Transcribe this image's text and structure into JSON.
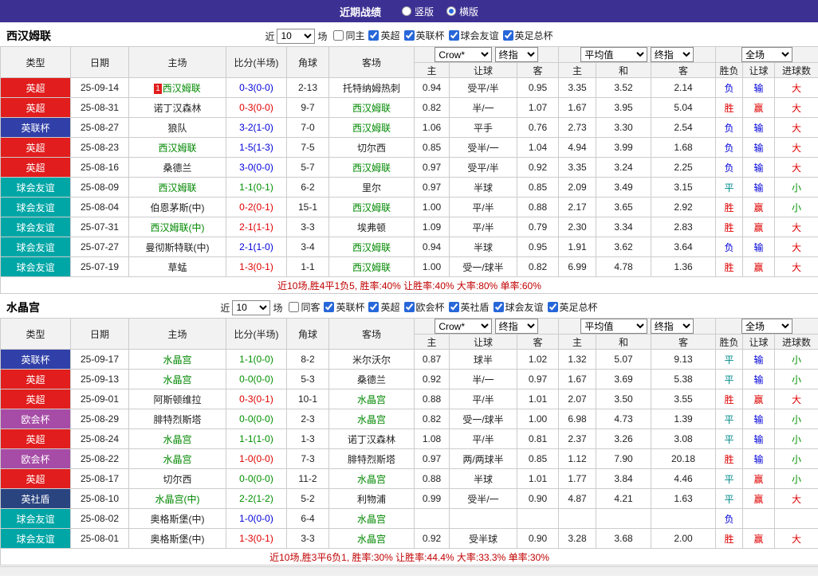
{
  "colors": {
    "topbar_bg": "#3c3193",
    "epl_red": "#e11d1d",
    "efl_cup_blue": "#3140a8",
    "friendly_teal": "#00a6a6",
    "uecl_purple": "#a64ca6",
    "community_shield_navy": "#2a4480",
    "focal_team_green": "#008800",
    "win_red": "#e00000",
    "loss_blue": "#0000d9",
    "draw_green": "#009000",
    "summary_red": "#c00000"
  },
  "topbar": {
    "title": "近期战绩",
    "radio_vertical": "竖版",
    "radio_horizontal": "横版",
    "selected": "横版"
  },
  "table_headers": {
    "col_type": "类型",
    "col_date": "日期",
    "col_home": "主场",
    "col_score": "比分(半场)",
    "col_corner": "角球",
    "col_away": "客场",
    "dd_bookmaker": "Crow*",
    "dd_final": "终指",
    "dd_average": "平均值",
    "dd_final2": "终指",
    "dd_scope": "全场",
    "sub_home": "主",
    "sub_handicap": "让球",
    "sub_away": "客",
    "sub_avg_home": "主",
    "sub_avg_draw": "和",
    "sub_avg_away": "客",
    "sub_result": "胜负",
    "sub_asian": "让球",
    "sub_goals": "进球数"
  },
  "sections": [
    {
      "team": "西汉姆联",
      "filter": {
        "near_label": "近",
        "count": "10",
        "unit_label": "场",
        "checks": [
          {
            "label": "同主",
            "checked": false
          },
          {
            "label": "英超",
            "checked": true
          },
          {
            "label": "英联杯",
            "checked": true
          },
          {
            "label": "球会友谊",
            "checked": true
          },
          {
            "label": "英足总杯",
            "checked": true
          }
        ]
      },
      "rows": [
        {
          "type": "英超",
          "type_color": "epl",
          "date": "25-09-14",
          "home": "西汉姆联",
          "home_focal": true,
          "home_badge": "1",
          "score": "0-3(0-0)",
          "score_color": "loss",
          "corner": "2-13",
          "away": "托特纳姆热刺",
          "away_focal": false,
          "crown_home": "0.94",
          "handicap": "受平/半",
          "crown_away": "0.95",
          "avg_home": "3.35",
          "avg_draw": "3.52",
          "avg_away": "2.14",
          "result": "负",
          "result_color": "blue",
          "asian": "输",
          "asian_color": "blue",
          "goals": "大",
          "goals_color": "red"
        },
        {
          "type": "英超",
          "type_color": "epl",
          "date": "25-08-31",
          "home": "诺丁汉森林",
          "home_focal": false,
          "score": "0-3(0-0)",
          "score_color": "win",
          "corner": "9-7",
          "away": "西汉姆联",
          "away_focal": true,
          "crown_home": "0.82",
          "handicap": "半/一",
          "crown_away": "1.07",
          "avg_home": "1.67",
          "avg_draw": "3.95",
          "avg_away": "5.04",
          "result": "胜",
          "result_color": "red",
          "asian": "赢",
          "asian_color": "red",
          "goals": "大",
          "goals_color": "red"
        },
        {
          "type": "英联杯",
          "type_color": "eflcup",
          "date": "25-08-27",
          "home": "狼队",
          "home_focal": false,
          "score": "3-2(1-0)",
          "score_color": "loss",
          "corner": "7-0",
          "away": "西汉姆联",
          "away_focal": true,
          "crown_home": "1.06",
          "handicap": "平手",
          "crown_away": "0.76",
          "avg_home": "2.73",
          "avg_draw": "3.30",
          "avg_away": "2.54",
          "result": "负",
          "result_color": "blue",
          "asian": "输",
          "asian_color": "blue",
          "goals": "大",
          "goals_color": "red"
        },
        {
          "type": "英超",
          "type_color": "epl",
          "date": "25-08-23",
          "home": "西汉姆联",
          "home_focal": true,
          "score": "1-5(1-3)",
          "score_color": "loss",
          "corner": "7-5",
          "away": "切尔西",
          "away_focal": false,
          "crown_home": "0.85",
          "handicap": "受半/一",
          "crown_away": "1.04",
          "avg_home": "4.94",
          "avg_draw": "3.99",
          "avg_away": "1.68",
          "result": "负",
          "result_color": "blue",
          "asian": "输",
          "asian_color": "blue",
          "goals": "大",
          "goals_color": "red"
        },
        {
          "type": "英超",
          "type_color": "epl",
          "date": "25-08-16",
          "home": "桑德兰",
          "home_focal": false,
          "score": "3-0(0-0)",
          "score_color": "loss",
          "corner": "5-7",
          "away": "西汉姆联",
          "away_focal": true,
          "crown_home": "0.97",
          "handicap": "受平/半",
          "crown_away": "0.92",
          "avg_home": "3.35",
          "avg_draw": "3.24",
          "avg_away": "2.25",
          "result": "负",
          "result_color": "blue",
          "asian": "输",
          "asian_color": "blue",
          "goals": "大",
          "goals_color": "red"
        },
        {
          "type": "球会友谊",
          "type_color": "friendly",
          "date": "25-08-09",
          "home": "西汉姆联",
          "home_focal": true,
          "score": "1-1(0-1)",
          "score_color": "draw",
          "corner": "6-2",
          "away": "里尔",
          "away_focal": false,
          "crown_home": "0.97",
          "handicap": "半球",
          "crown_away": "0.85",
          "avg_home": "2.09",
          "avg_draw": "3.49",
          "avg_away": "3.15",
          "result": "平",
          "result_color": "teal",
          "asian": "输",
          "asian_color": "blue",
          "goals": "小",
          "goals_color": "green"
        },
        {
          "type": "球会友谊",
          "type_color": "friendly",
          "date": "25-08-04",
          "home": "伯恩茅斯(中)",
          "home_focal": false,
          "score": "0-2(0-1)",
          "score_color": "win",
          "corner": "15-1",
          "away": "西汉姆联",
          "away_focal": true,
          "crown_home": "1.00",
          "handicap": "平/半",
          "crown_away": "0.88",
          "avg_home": "2.17",
          "avg_draw": "3.65",
          "avg_away": "2.92",
          "result": "胜",
          "result_color": "red",
          "asian": "赢",
          "asian_color": "red",
          "goals": "小",
          "goals_color": "green"
        },
        {
          "type": "球会友谊",
          "type_color": "friendly",
          "date": "25-07-31",
          "home": "西汉姆联(中)",
          "home_focal": true,
          "score": "2-1(1-1)",
          "score_color": "win",
          "corner": "3-3",
          "away": "埃弗顿",
          "away_focal": false,
          "crown_home": "1.09",
          "handicap": "平/半",
          "crown_away": "0.79",
          "avg_home": "2.30",
          "avg_draw": "3.34",
          "avg_away": "2.83",
          "result": "胜",
          "result_color": "red",
          "asian": "赢",
          "asian_color": "red",
          "goals": "大",
          "goals_color": "red"
        },
        {
          "type": "球会友谊",
          "type_color": "friendly",
          "date": "25-07-27",
          "home": "曼彻斯特联(中)",
          "home_focal": false,
          "score": "2-1(1-0)",
          "score_color": "loss",
          "corner": "3-4",
          "away": "西汉姆联",
          "away_focal": true,
          "crown_home": "0.94",
          "handicap": "半球",
          "crown_away": "0.95",
          "avg_home": "1.91",
          "avg_draw": "3.62",
          "avg_away": "3.64",
          "result": "负",
          "result_color": "blue",
          "asian": "输",
          "asian_color": "blue",
          "goals": "大",
          "goals_color": "red"
        },
        {
          "type": "球会友谊",
          "type_color": "friendly",
          "date": "25-07-19",
          "home": "草蜢",
          "home_focal": false,
          "score": "1-3(0-1)",
          "score_color": "win",
          "corner": "1-1",
          "away": "西汉姆联",
          "away_focal": true,
          "crown_home": "1.00",
          "handicap": "受一/球半",
          "crown_away": "0.82",
          "avg_home": "6.99",
          "avg_draw": "4.78",
          "avg_away": "1.36",
          "result": "胜",
          "result_color": "red",
          "asian": "赢",
          "asian_color": "red",
          "goals": "大",
          "goals_color": "red"
        }
      ],
      "summary": "近10场,胜4平1负5, 胜率:40% 让胜率:40% 大率:80% 单率:60%"
    },
    {
      "team": "水晶宫",
      "filter": {
        "near_label": "近",
        "count": "10",
        "unit_label": "场",
        "checks": [
          {
            "label": "同客",
            "checked": false
          },
          {
            "label": "英联杯",
            "checked": true
          },
          {
            "label": "英超",
            "checked": true
          },
          {
            "label": "欧会杯",
            "checked": true
          },
          {
            "label": "英社盾",
            "checked": true
          },
          {
            "label": "球会友谊",
            "checked": true
          },
          {
            "label": "英足总杯",
            "checked": true
          }
        ]
      },
      "rows": [
        {
          "type": "英联杯",
          "type_color": "eflcup",
          "date": "25-09-17",
          "home": "水晶宫",
          "home_focal": true,
          "score": "1-1(0-0)",
          "score_color": "draw",
          "corner": "8-2",
          "away": "米尔沃尔",
          "away_focal": false,
          "crown_home": "0.87",
          "handicap": "球半",
          "crown_away": "1.02",
          "avg_home": "1.32",
          "avg_draw": "5.07",
          "avg_away": "9.13",
          "result": "平",
          "result_color": "teal",
          "asian": "输",
          "asian_color": "blue",
          "goals": "小",
          "goals_color": "green"
        },
        {
          "type": "英超",
          "type_color": "epl",
          "date": "25-09-13",
          "home": "水晶宫",
          "home_focal": true,
          "score": "0-0(0-0)",
          "score_color": "draw",
          "corner": "5-3",
          "away": "桑德兰",
          "away_focal": false,
          "crown_home": "0.92",
          "handicap": "半/一",
          "crown_away": "0.97",
          "avg_home": "1.67",
          "avg_draw": "3.69",
          "avg_away": "5.38",
          "result": "平",
          "result_color": "teal",
          "asian": "输",
          "asian_color": "blue",
          "goals": "小",
          "goals_color": "green"
        },
        {
          "type": "英超",
          "type_color": "epl",
          "date": "25-09-01",
          "home": "阿斯顿维拉",
          "home_focal": false,
          "score": "0-3(0-1)",
          "score_color": "win",
          "corner": "10-1",
          "away": "水晶宫",
          "away_focal": true,
          "crown_home": "0.88",
          "handicap": "平/半",
          "crown_away": "1.01",
          "avg_home": "2.07",
          "avg_draw": "3.50",
          "avg_away": "3.55",
          "result": "胜",
          "result_color": "red",
          "asian": "赢",
          "asian_color": "red",
          "goals": "大",
          "goals_color": "red"
        },
        {
          "type": "欧会杯",
          "type_color": "uecl",
          "date": "25-08-29",
          "home": "腓特烈斯塔",
          "home_focal": false,
          "score": "0-0(0-0)",
          "score_color": "draw",
          "corner": "2-3",
          "away": "水晶宫",
          "away_focal": true,
          "crown_home": "0.82",
          "handicap": "受一/球半",
          "crown_away": "1.00",
          "avg_home": "6.98",
          "avg_draw": "4.73",
          "avg_away": "1.39",
          "result": "平",
          "result_color": "teal",
          "asian": "输",
          "asian_color": "blue",
          "goals": "小",
          "goals_color": "green"
        },
        {
          "type": "英超",
          "type_color": "epl",
          "date": "25-08-24",
          "home": "水晶宫",
          "home_focal": true,
          "score": "1-1(1-0)",
          "score_color": "draw",
          "corner": "1-3",
          "away": "诺丁汉森林",
          "away_focal": false,
          "crown_home": "1.08",
          "handicap": "平/半",
          "crown_away": "0.81",
          "avg_home": "2.37",
          "avg_draw": "3.26",
          "avg_away": "3.08",
          "result": "平",
          "result_color": "teal",
          "asian": "输",
          "asian_color": "blue",
          "goals": "小",
          "goals_color": "green"
        },
        {
          "type": "欧会杯",
          "type_color": "uecl",
          "date": "25-08-22",
          "home": "水晶宫",
          "home_focal": true,
          "score": "1-0(0-0)",
          "score_color": "win",
          "corner": "7-3",
          "away": "腓特烈斯塔",
          "away_focal": false,
          "crown_home": "0.97",
          "handicap": "两/两球半",
          "crown_away": "0.85",
          "avg_home": "1.12",
          "avg_draw": "7.90",
          "avg_away": "20.18",
          "result": "胜",
          "result_color": "red",
          "asian": "输",
          "asian_color": "blue",
          "goals": "小",
          "goals_color": "green"
        },
        {
          "type": "英超",
          "type_color": "epl",
          "date": "25-08-17",
          "home": "切尔西",
          "home_focal": false,
          "score": "0-0(0-0)",
          "score_color": "draw",
          "corner": "11-2",
          "away": "水晶宫",
          "away_focal": true,
          "crown_home": "0.88",
          "handicap": "半球",
          "crown_away": "1.01",
          "avg_home": "1.77",
          "avg_draw": "3.84",
          "avg_away": "4.46",
          "result": "平",
          "result_color": "teal",
          "asian": "赢",
          "asian_color": "red",
          "goals": "小",
          "goals_color": "green"
        },
        {
          "type": "英社盾",
          "type_color": "shield",
          "date": "25-08-10",
          "home": "水晶宫(中)",
          "home_focal": true,
          "score": "2-2(1-2)",
          "score_color": "draw",
          "corner": "5-2",
          "away": "利物浦",
          "away_focal": false,
          "crown_home": "0.99",
          "handicap": "受半/一",
          "crown_away": "0.90",
          "avg_home": "4.87",
          "avg_draw": "4.21",
          "avg_away": "1.63",
          "result": "平",
          "result_color": "teal",
          "asian": "赢",
          "asian_color": "red",
          "goals": "大",
          "goals_color": "red"
        },
        {
          "type": "球会友谊",
          "type_color": "friendly",
          "date": "25-08-02",
          "home": "奥格斯堡(中)",
          "home_focal": false,
          "score": "1-0(0-0)",
          "score_color": "loss",
          "corner": "6-4",
          "away": "水晶宫",
          "away_focal": true,
          "crown_home": "",
          "handicap": "",
          "crown_away": "",
          "avg_home": "",
          "avg_draw": "",
          "avg_away": "",
          "result": "负",
          "result_color": "blue",
          "asian": "",
          "goals": ""
        },
        {
          "type": "球会友谊",
          "type_color": "friendly",
          "date": "25-08-01",
          "home": "奥格斯堡(中)",
          "home_focal": false,
          "score": "1-3(0-1)",
          "score_color": "win",
          "corner": "3-3",
          "away": "水晶宫",
          "away_focal": true,
          "crown_home": "0.92",
          "handicap": "受半球",
          "crown_away": "0.90",
          "avg_home": "3.28",
          "avg_draw": "3.68",
          "avg_away": "2.00",
          "result": "胜",
          "result_color": "red",
          "asian": "赢",
          "asian_color": "red",
          "goals": "大",
          "goals_color": "red"
        }
      ],
      "summary": "近10场,胜3平6负1, 胜率:30% 让胜率:44.4% 大率:33.3% 单率:30%"
    }
  ]
}
